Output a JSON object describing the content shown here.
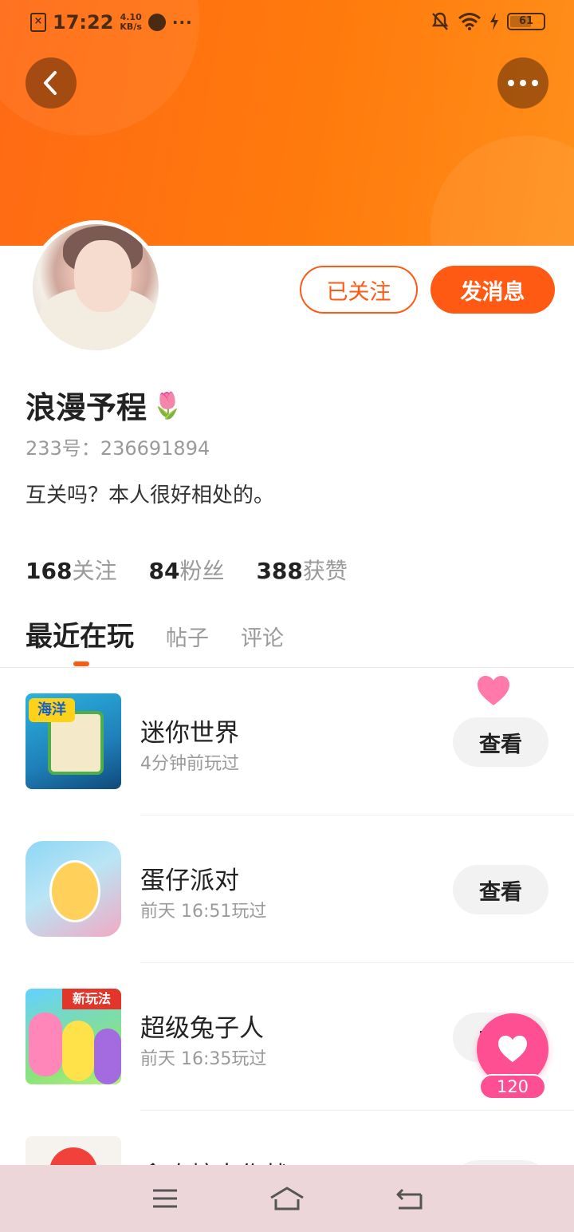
{
  "status_bar": {
    "time": "17:22",
    "speed_value": "4.10",
    "speed_unit": "KB/s",
    "dots": "···",
    "battery": "61"
  },
  "header": {
    "back_icon": "chevron-left-icon",
    "more_icon": "more-dots-icon",
    "banner_color": "#ff7a0c"
  },
  "profile": {
    "username": "浪漫予程",
    "username_emoji": "🌷",
    "id_text": "233号：236691894",
    "bio": "互关吗？本人很好相处的。",
    "follow_label": "已关注",
    "message_label": "发消息",
    "accent_color": "#ff5a14"
  },
  "stats": [
    {
      "value": "168",
      "label": "关注"
    },
    {
      "value": "84",
      "label": "粉丝"
    },
    {
      "value": "388",
      "label": "获赞"
    }
  ],
  "tabs": [
    {
      "label": "最近在玩",
      "active": true
    },
    {
      "label": "帖子",
      "active": false
    },
    {
      "label": "评论",
      "active": false
    }
  ],
  "games": [
    {
      "name": "迷你世界",
      "time": "4分钟前玩过",
      "button": "查看",
      "icon_tag": "海洋"
    },
    {
      "name": "蛋仔派对",
      "time": "前天 16:51玩过",
      "button": "查看"
    },
    {
      "name": "超级兔子人",
      "time": "前天 16:35玩过",
      "button": "查看",
      "icon_tag": "新玩法"
    },
    {
      "name": "贪吃蛇大作战",
      "time": "",
      "button": "查看"
    }
  ],
  "like_fab": {
    "count": "120",
    "color": "#ff4f93"
  },
  "nav": {
    "menu_icon": "menu-icon",
    "home_icon": "home-icon",
    "back_icon": "return-icon"
  }
}
